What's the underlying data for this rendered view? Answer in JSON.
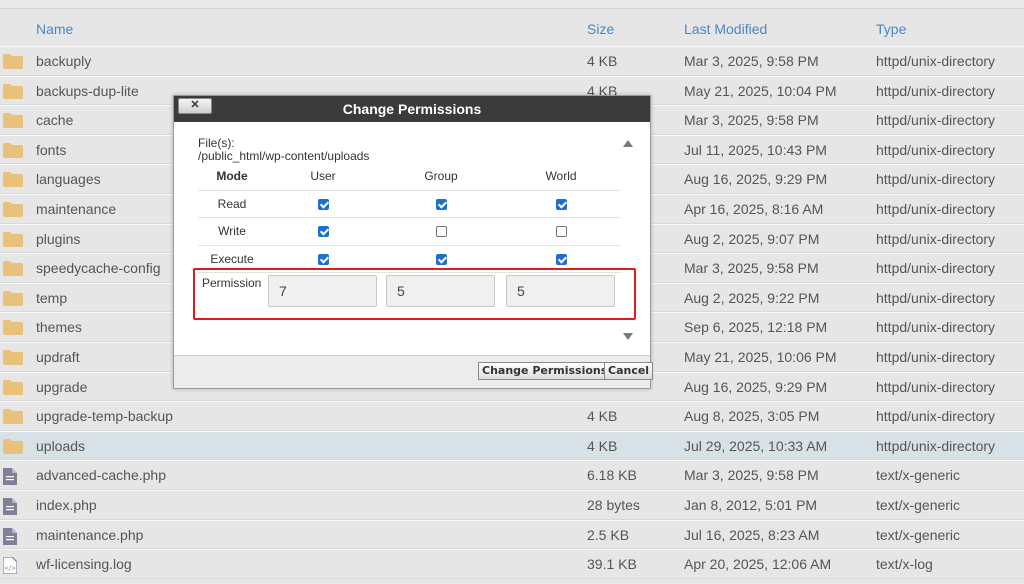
{
  "columns": {
    "name": "Name",
    "size": "Size",
    "modified": "Last Modified",
    "type": "Type"
  },
  "colors": {
    "accent": "#4a86c5",
    "folder": "#e8c17a",
    "highlight": "#e01b1b",
    "selected_row": "#d8e1e6"
  },
  "rows": [
    {
      "name": "backuply",
      "size": "4 KB",
      "modified": "Mar 3, 2025, 9:58 PM",
      "type": "httpd/unix-directory",
      "icon": "folder-icon"
    },
    {
      "name": "backups-dup-lite",
      "size": "4 KB",
      "modified": "May 21, 2025, 10:04 PM",
      "type": "httpd/unix-directory",
      "icon": "folder-icon"
    },
    {
      "name": "cache",
      "size": "",
      "modified": "Mar 3, 2025, 9:58 PM",
      "type": "httpd/unix-directory",
      "icon": "folder-icon"
    },
    {
      "name": "fonts",
      "size": "",
      "modified": "Jul 11, 2025, 10:43 PM",
      "type": "httpd/unix-directory",
      "icon": "folder-icon"
    },
    {
      "name": "languages",
      "size": "",
      "modified": "Aug 16, 2025, 9:29 PM",
      "type": "httpd/unix-directory",
      "icon": "folder-icon"
    },
    {
      "name": "maintenance",
      "size": "",
      "modified": "Apr 16, 2025, 8:16 AM",
      "type": "httpd/unix-directory",
      "icon": "folder-icon"
    },
    {
      "name": "plugins",
      "size": "",
      "modified": "Aug 2, 2025, 9:07 PM",
      "type": "httpd/unix-directory",
      "icon": "folder-icon"
    },
    {
      "name": "speedycache-config",
      "size": "",
      "modified": "Mar 3, 2025, 9:58 PM",
      "type": "httpd/unix-directory",
      "icon": "folder-icon"
    },
    {
      "name": "temp",
      "size": "",
      "modified": "Aug 2, 2025, 9:22 PM",
      "type": "httpd/unix-directory",
      "icon": "folder-icon"
    },
    {
      "name": "themes",
      "size": "",
      "modified": "Sep 6, 2025, 12:18 PM",
      "type": "httpd/unix-directory",
      "icon": "folder-icon"
    },
    {
      "name": "updraft",
      "size": "",
      "modified": "May 21, 2025, 10:06 PM",
      "type": "httpd/unix-directory",
      "icon": "folder-icon"
    },
    {
      "name": "upgrade",
      "size": "",
      "modified": "Aug 16, 2025, 9:29 PM",
      "type": "httpd/unix-directory",
      "icon": "folder-icon"
    },
    {
      "name": "upgrade-temp-backup",
      "size": "4 KB",
      "modified": "Aug 8, 2025, 3:05 PM",
      "type": "httpd/unix-directory",
      "icon": "folder-icon"
    },
    {
      "name": "uploads",
      "size": "4 KB",
      "modified": "Jul 29, 2025, 10:33 AM",
      "type": "httpd/unix-directory",
      "icon": "folder-icon",
      "selected": true
    },
    {
      "name": "advanced-cache.php",
      "size": "6.18 KB",
      "modified": "Mar 3, 2025, 9:58 PM",
      "type": "text/x-generic",
      "icon": "file-icon"
    },
    {
      "name": "index.php",
      "size": "28 bytes",
      "modified": "Jan 8, 2012, 5:01 PM",
      "type": "text/x-generic",
      "icon": "file-icon"
    },
    {
      "name": "maintenance.php",
      "size": "2.5 KB",
      "modified": "Jul 16, 2025, 8:23 AM",
      "type": "text/x-generic",
      "icon": "file-icon"
    },
    {
      "name": "wf-licensing.log",
      "size": "39.1 KB",
      "modified": "Apr 20, 2025, 12:06 AM",
      "type": "text/x-log",
      "icon": "code-file-icon"
    }
  ],
  "dialog": {
    "title": "Change Permissions",
    "close_label": "✕",
    "files_label": "File(s):",
    "file_path": "/public_html/wp-content/uploads",
    "headers": {
      "mode": "Mode",
      "user": "User",
      "group": "Group",
      "world": "World"
    },
    "modes": [
      {
        "label": "Read",
        "user": true,
        "group": true,
        "world": true
      },
      {
        "label": "Write",
        "user": true,
        "group": false,
        "world": false
      },
      {
        "label": "Execute",
        "user": true,
        "group": true,
        "world": true
      }
    ],
    "permission_label": "Permission",
    "permission_values": {
      "user": "7",
      "group": "5",
      "world": "5"
    },
    "submit_label": "Change Permissions",
    "cancel_label": "Cancel"
  }
}
